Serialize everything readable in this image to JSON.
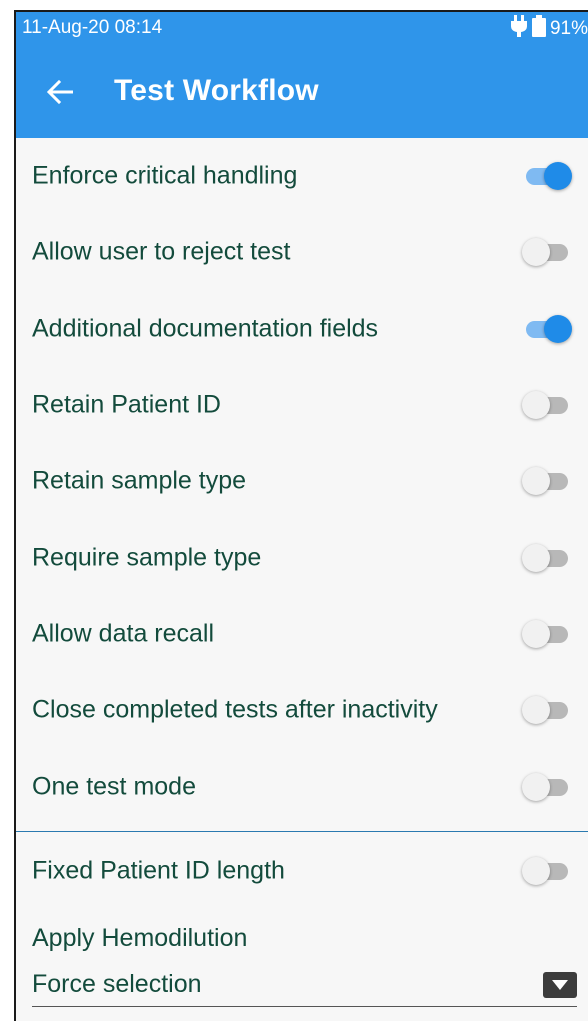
{
  "status_bar": {
    "datetime": "11-Aug-20 08:14",
    "battery_percent": "91%"
  },
  "app_bar": {
    "title": "Test Workflow",
    "back_icon": "arrow-left-icon"
  },
  "settings": [
    {
      "label": "Enforce critical handling",
      "on": true
    },
    {
      "label": "Allow user to reject test",
      "on": false
    },
    {
      "label": "Additional documentation fields",
      "on": true
    },
    {
      "label": "Retain Patient ID",
      "on": false
    },
    {
      "label": "Retain sample type",
      "on": false
    },
    {
      "label": "Require sample type",
      "on": false
    },
    {
      "label": "Allow data recall",
      "on": false
    },
    {
      "label": "Close completed tests after inactivity",
      "on": false
    },
    {
      "label": "One test mode",
      "on": false
    }
  ],
  "settings2": [
    {
      "label": "Fixed Patient ID length",
      "on": false
    }
  ],
  "hemodilution": {
    "title": "Apply Hemodilution",
    "selected": "Force selection"
  },
  "colors": {
    "primary": "#2f95ea",
    "switch_on": "#1f8be8",
    "text": "#134b3c"
  }
}
